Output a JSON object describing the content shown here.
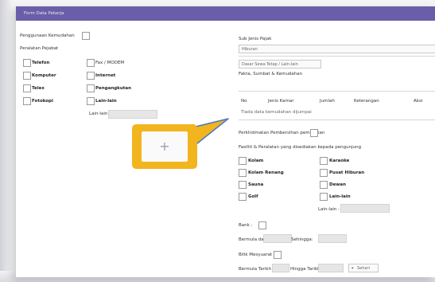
{
  "window": {
    "title": "Form Data Pekerja"
  },
  "left": {
    "check_label": "Penggunaan Kemudahan",
    "group_label": "Peralatan Pejabat",
    "col1": [
      "Telefon",
      "Komputer",
      "Telex",
      "Fotokopi"
    ],
    "col2": [
      "Fax / MODEM",
      "Internet",
      "Pengangkutan",
      "Lain-lain"
    ],
    "other_label": "Lain-lain"
  },
  "right": {
    "sub_label": "Sub Jenis Pajak",
    "sub_value": "Hiburan",
    "lease_label": "Dasar Sewa Tetap / Lain-lain",
    "fac_label": "Fakta, Sumbat & Kemudahan",
    "table_headers": [
      "No",
      "Jenis Kamar",
      "Jumlah",
      "Keterangan",
      "Aksi"
    ],
    "table_empty": "Tiada data kemudahan dijumpai",
    "service_label": "Perkhidmatan Pembersihan pemandian",
    "fac2_label": "Fasiliti & Peralatan yang disediakan kepada pengunjung",
    "col1": [
      "Kolam",
      "Kolam Renang",
      "Sauna",
      "Golf"
    ],
    "col2": [
      "Karaoke",
      "Pusat Hiburan",
      "Dewan",
      "Lain-lain"
    ],
    "other_label": "Lain-lain :",
    "bank_label": "Bank :",
    "bank_from_label": "Bermula dari:",
    "bank_to_label": "Sehingga:",
    "meet_label": "Bilik Mesyuarat",
    "meet_from_label": "Bermula Tarikh",
    "meet_to_label": "Hingga Tarikh",
    "meet_unit": "Sehari"
  },
  "plus_icon": "plus-icon",
  "colors": {
    "titlebar": "#6b5ea8",
    "callout": "#f2b51d",
    "callout_stroke": "#4a78c2"
  }
}
